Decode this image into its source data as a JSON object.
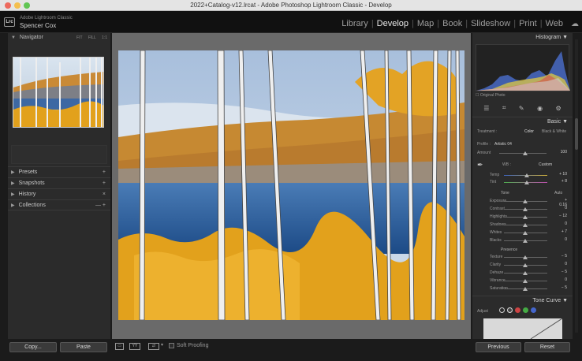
{
  "window": {
    "title": "2022+Catalog-v12.lrcat - Adobe Photoshop Lightroom Classic - Develop"
  },
  "identity": {
    "logo": "Lrc",
    "app_name": "Adobe Lightroom Classic",
    "user": "Spencer Cox"
  },
  "modules": {
    "items": [
      "Library",
      "Develop",
      "Map",
      "Book",
      "Slideshow",
      "Print",
      "Web"
    ],
    "active": "Develop"
  },
  "left_panel": {
    "navigator": {
      "label": "Navigator",
      "zoom_options": [
        "FIT",
        "FILL",
        "1:1"
      ]
    },
    "sections": [
      {
        "label": "Presets",
        "control": "+"
      },
      {
        "label": "Snapshots",
        "control": "+"
      },
      {
        "label": "History",
        "control": "×"
      },
      {
        "label": "Collections",
        "control": "— +"
      }
    ],
    "copy_label": "Copy...",
    "paste_label": "Paste"
  },
  "toolbar": {
    "soft_proofing_label": "Soft Proofing"
  },
  "right_panel": {
    "histogram_label": "Histogram",
    "original_photo_label": "Original Photo",
    "basic": {
      "label": "Basic",
      "treatment_label": "Treatment :",
      "color_label": "Color",
      "bw_label": "Black & White",
      "profile_label": "Profile :",
      "profile_value": "Artistic 04",
      "amount_label": "Amount",
      "amount_value": "100",
      "wb_label": "WB :",
      "wb_value": "Custom",
      "temp_label": "Temp",
      "temp_value": "+ 10",
      "tint_label": "Tint",
      "tint_value": "+ 8",
      "tone_label": "Tone",
      "auto_label": "Auto",
      "tone_sliders": [
        {
          "label": "Exposure",
          "value": "+ 0.16"
        },
        {
          "label": "Contrast",
          "value": "0"
        },
        {
          "label": "Highlights",
          "value": "− 12"
        },
        {
          "label": "Shadows",
          "value": "0"
        },
        {
          "label": "Whites",
          "value": "+ 7"
        },
        {
          "label": "Blacks",
          "value": "0"
        }
      ],
      "presence_label": "Presence",
      "presence_sliders": [
        {
          "label": "Texture",
          "value": "− 5"
        },
        {
          "label": "Clarity",
          "value": "0"
        },
        {
          "label": "Dehaze",
          "value": "− 5"
        },
        {
          "label": "Vibrance",
          "value": "0"
        },
        {
          "label": "Saturation",
          "value": "− 5"
        }
      ]
    },
    "tone_curve_label": "Tone Curve",
    "adjust_label": "Adjust",
    "previous_label": "Previous",
    "reset_label": "Reset"
  },
  "icons": [
    "close-icon",
    "minimize-icon",
    "zoom-icon",
    "cloud-icon",
    "crop-icon",
    "healing-icon",
    "brush-icon",
    "redeye-icon",
    "masking-icon",
    "eyedropper-icon"
  ]
}
